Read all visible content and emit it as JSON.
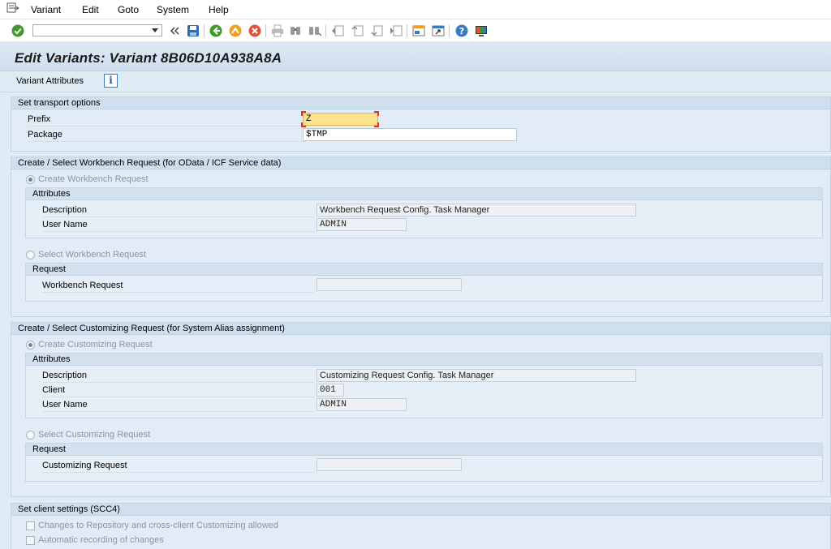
{
  "menu": {
    "items": [
      "Variant",
      "Edit",
      "Goto",
      "System",
      "Help"
    ]
  },
  "toolbar": {
    "command_field_value": "",
    "icons": [
      "enter-icon",
      "save-icon",
      "back-icon",
      "exit-icon",
      "cancel-icon",
      "print-icon",
      "find-icon",
      "find-next-icon",
      "first-page-icon",
      "previous-page-icon",
      "next-page-icon",
      "last-page-icon",
      "new-session-icon",
      "shortcut-icon",
      "help-icon",
      "customize-layout-icon"
    ]
  },
  "title": "Edit Variants: Variant 8B06D10A938A8A",
  "app_toolbar": {
    "label": "Variant Attributes",
    "info_glyph": "i"
  },
  "transport": {
    "header": "Set transport options",
    "prefix_label": "Prefix",
    "prefix_value": "Z",
    "package_label": "Package",
    "package_value": "$TMP"
  },
  "workbench": {
    "header": "Create / Select Workbench Request (for OData / ICF Service data)",
    "create_label": "Create Workbench Request",
    "attributes_header": "Attributes",
    "description_label": "Description",
    "description_value": "Workbench Request Config. Task Manager",
    "username_label": "User Name",
    "username_value": "ADMIN",
    "select_label": "Select Workbench Request",
    "request_header": "Request",
    "request_label": "Workbench Request",
    "request_value": ""
  },
  "customizing": {
    "header": "Create / Select Customizing Request (for System Alias assignment)",
    "create_label": "Create Customizing Request",
    "attributes_header": "Attributes",
    "description_label": "Description",
    "description_value": "Customizing Request Config. Task Manager",
    "client_label": "Client",
    "client_value": "001",
    "username_label": "User Name",
    "username_value": "ADMIN",
    "select_label": "Select Customizing Request",
    "request_header": "Request",
    "request_label": "Customizing Request",
    "request_value": ""
  },
  "client_settings": {
    "header": "Set client settings (SCC4)",
    "option1": "Changes to Repository and cross-client Customizing allowed",
    "option2": "Automatic recording of changes"
  },
  "colors": {
    "background": "#dfebf5",
    "group_header": "#d0dfee",
    "focus_field": "#fbe38c"
  }
}
